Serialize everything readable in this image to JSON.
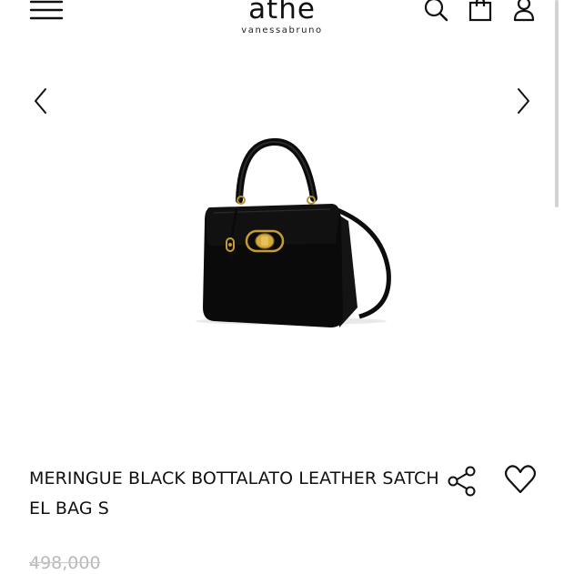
{
  "header": {
    "logo_main": "athe",
    "logo_sub": "vanessabruno",
    "icons": {
      "menu": "hamburger-menu-icon",
      "search": "search-icon",
      "cart": "shopping-bag-icon",
      "account": "user-icon"
    }
  },
  "gallery": {
    "prev_icon": "chevron-left-icon",
    "next_icon": "chevron-right-icon",
    "image_alt": "MERINGUE BLACK BOTTALATO LEATHER SATCHEL BAG S"
  },
  "product": {
    "name": "MERINGUE BLACK BOTTALATO LEATHER SATCHEL BAG S",
    "price": "498,000",
    "share_icon": "share-icon",
    "wishlist_icon": "heart-icon"
  },
  "colors": {
    "text": "#111111",
    "price_muted": "#b9b9b9",
    "background": "#ffffff",
    "scroll_thumb": "#d3d3d3"
  }
}
